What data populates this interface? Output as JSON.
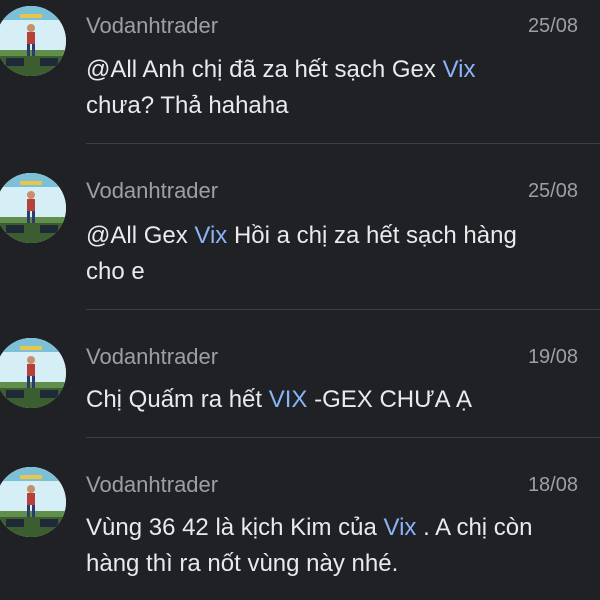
{
  "messages": [
    {
      "sender": "Vodanhtrader",
      "date": "25/08",
      "lines": [
        [
          {
            "text": "@All Anh chị đã za hết sạch Gex ",
            "hl": false
          },
          {
            "text": "Vix",
            "hl": true
          }
        ],
        [
          {
            "text": "chưa? Thả hahaha",
            "hl": false
          }
        ]
      ]
    },
    {
      "sender": "Vodanhtrader",
      "date": "25/08",
      "lines": [
        [
          {
            "text": "@All Gex ",
            "hl": false
          },
          {
            "text": "Vix",
            "hl": true
          },
          {
            "text": " Hồi a chị za hết sạch hàng",
            "hl": false
          }
        ],
        [
          {
            "text": "cho e",
            "hl": false
          }
        ]
      ]
    },
    {
      "sender": "Vodanhtrader",
      "date": "19/08",
      "lines": [
        [
          {
            "text": "Chị Quấm ra hết ",
            "hl": false
          },
          {
            "text": "VIX",
            "hl": true
          },
          {
            "text": " -GEX CHƯA Ạ",
            "hl": false
          }
        ]
      ]
    },
    {
      "sender": "Vodanhtrader",
      "date": "18/08",
      "lines": [
        [
          {
            "text": "Vùng 36 42 là kịch Kim của ",
            "hl": false
          },
          {
            "text": "Vix",
            "hl": true
          },
          {
            "text": " . A chị còn",
            "hl": false
          }
        ],
        [
          {
            "text": "hàng thì ra nốt vùng này nhé.",
            "hl": false
          }
        ]
      ]
    }
  ],
  "colors": {
    "background": "#202124",
    "highlight": "#8ab4f8",
    "meta": "#9aa0a6",
    "body_text": "#e8eaed"
  }
}
